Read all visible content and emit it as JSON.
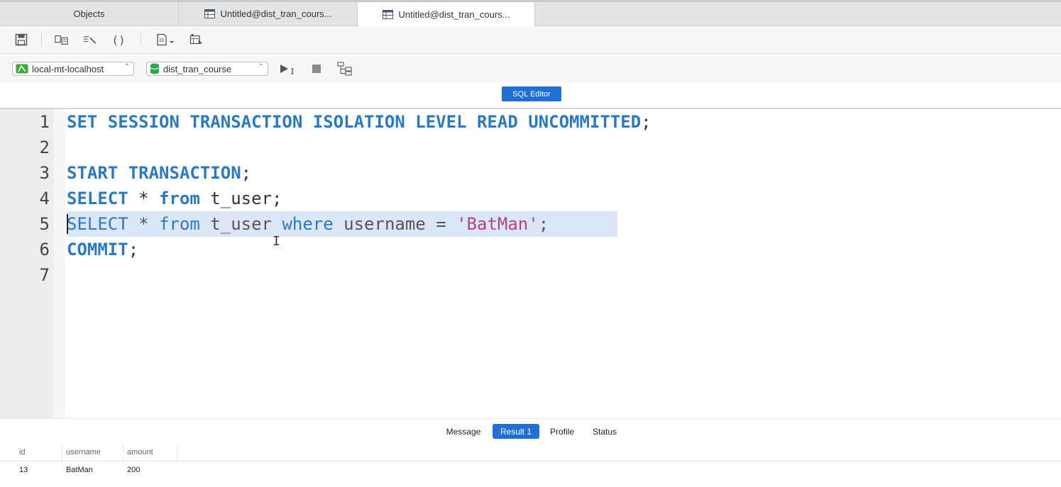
{
  "tabs": [
    {
      "label": "Objects",
      "icon": "none"
    },
    {
      "label": "Untitled@dist_tran_cours...",
      "icon": "query-table-icon"
    },
    {
      "label": "Untitled@dist_tran_cours...",
      "icon": "query-table-icon"
    }
  ],
  "toolbar": {
    "icons": [
      "save-icon",
      "format-icon",
      "beautify-icon",
      "brackets-icon",
      "snippet-icon",
      "table-icon"
    ]
  },
  "connection": {
    "server": "local-mt-localhost",
    "database": "dist_tran_course"
  },
  "editor": {
    "mode_label": "SQL Editor",
    "lines": [
      {
        "num": "1",
        "tokens": [
          {
            "t": "SET SESSION TRANSACTION ISOLATION LEVEL READ UNCOMMITTED",
            "c": "kw"
          },
          {
            "t": ";",
            "c": "id"
          }
        ]
      },
      {
        "num": "2",
        "tokens": []
      },
      {
        "num": "3",
        "tokens": [
          {
            "t": "START TRANSACTION",
            "c": "kw"
          },
          {
            "t": ";",
            "c": "id"
          }
        ]
      },
      {
        "num": "4",
        "tokens": [
          {
            "t": "SELECT",
            "c": "kw"
          },
          {
            "t": " * ",
            "c": "id"
          },
          {
            "t": "from",
            "c": "kw"
          },
          {
            "t": " t_user;",
            "c": "id"
          }
        ]
      },
      {
        "num": "5",
        "tokens": [
          {
            "t": "SELECT",
            "c": "kwl"
          },
          {
            "t": " * ",
            "c": "idg"
          },
          {
            "t": "from",
            "c": "kwl"
          },
          {
            "t": " t_user ",
            "c": "idg"
          },
          {
            "t": "where",
            "c": "kwl"
          },
          {
            "t": " username = ",
            "c": "idg"
          },
          {
            "t": "'BatMan'",
            "c": "str"
          },
          {
            "t": ";",
            "c": "idg"
          }
        ]
      },
      {
        "num": "6",
        "tokens": [
          {
            "t": "COMMIT",
            "c": "kw"
          },
          {
            "t": ";",
            "c": "id"
          }
        ]
      },
      {
        "num": "7",
        "tokens": []
      }
    ]
  },
  "results": {
    "tabs": [
      "Message",
      "Result 1",
      "Profile",
      "Status"
    ],
    "active_tab": "Result 1",
    "columns": [
      "id",
      "username",
      "amount"
    ],
    "rows": [
      [
        "13",
        "BatMan",
        "200"
      ]
    ]
  },
  "colors": {
    "accent": "#1f6fd6",
    "keyword": "#2b79c2",
    "string": "#b2447a",
    "selection": "#dbe7f7"
  }
}
